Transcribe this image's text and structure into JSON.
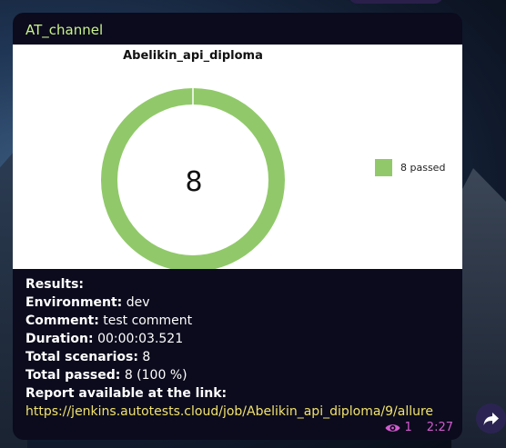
{
  "message": {
    "channel_name": "AT_channel",
    "chart": {
      "title": "Abelikin_api_diploma",
      "center_value": "8",
      "legend_label": "8 passed",
      "color": "#91c96a"
    },
    "results_title": "Results:",
    "lines": [
      {
        "label": "Environment:",
        "value": " dev"
      },
      {
        "label": "Comment:",
        "value": " test comment"
      },
      {
        "label": "Duration:",
        "value": " 00:00:03.521"
      },
      {
        "label": "Total scenarios:",
        "value": " 8"
      },
      {
        "label": "Total passed:",
        "value": " 8 (100 %)"
      }
    ],
    "link_label": "Report available at the link:",
    "link_url": "https://jenkins.autotests.cloud/job/Abelikin_api_diploma/9/allure",
    "views": "1",
    "time": "2:27"
  },
  "chart_data": {
    "type": "pie",
    "title": "Abelikin_api_diploma",
    "categories": [
      "passed"
    ],
    "values": [
      8
    ],
    "legend": [
      "8 passed"
    ],
    "center_label": "8",
    "legend_placement": "right"
  },
  "icons": {
    "views": "eye-icon",
    "forward": "share-arrow-icon"
  },
  "colors": {
    "channel_name": "#c9f28a",
    "link": "#f2e26b",
    "meta": "#d45bd0",
    "passed": "#91c96a"
  }
}
